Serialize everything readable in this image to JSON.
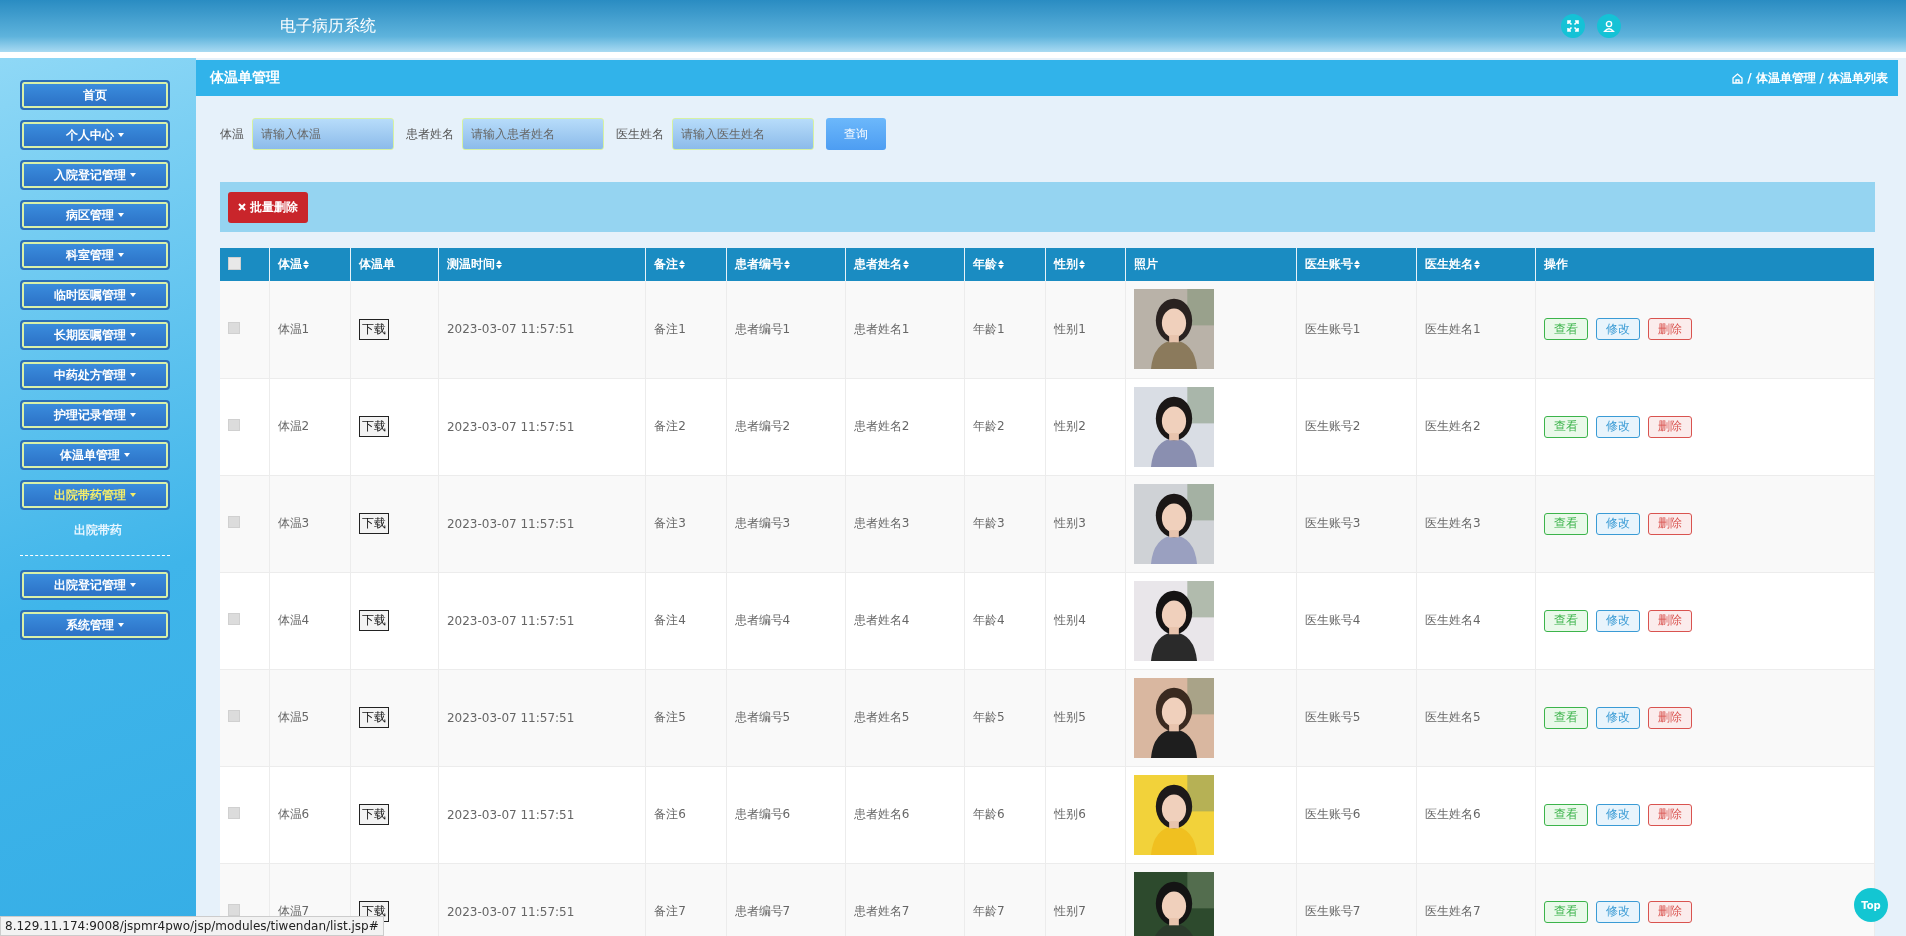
{
  "header": {
    "title": "电子病历系统"
  },
  "sidebar": {
    "items": [
      {
        "label": "首页",
        "has_caret": false,
        "selected": false
      },
      {
        "label": "个人中心",
        "has_caret": true,
        "selected": false
      },
      {
        "label": "入院登记管理",
        "has_caret": true,
        "selected": false
      },
      {
        "label": "病区管理",
        "has_caret": true,
        "selected": false
      },
      {
        "label": "科室管理",
        "has_caret": true,
        "selected": false
      },
      {
        "label": "临时医嘱管理",
        "has_caret": true,
        "selected": false
      },
      {
        "label": "长期医嘱管理",
        "has_caret": true,
        "selected": false
      },
      {
        "label": "中药处方管理",
        "has_caret": true,
        "selected": false
      },
      {
        "label": "护理记录管理",
        "has_caret": true,
        "selected": false
      },
      {
        "label": "体温单管理",
        "has_caret": true,
        "selected": false
      },
      {
        "label": "出院带药管理",
        "has_caret": true,
        "selected": true,
        "children": [
          "出院带药"
        ]
      },
      {
        "label": "出院登记管理",
        "has_caret": true,
        "selected": false
      },
      {
        "label": "系统管理",
        "has_caret": true,
        "selected": false
      }
    ]
  },
  "page": {
    "title": "体温单管理",
    "breadcrumb": {
      "separator": "/",
      "items": [
        "体温单管理",
        "体温单列表"
      ]
    }
  },
  "search": {
    "fields": [
      {
        "label": "体温",
        "placeholder": "请输入体温"
      },
      {
        "label": "患者姓名",
        "placeholder": "请输入患者姓名"
      },
      {
        "label": "医生姓名",
        "placeholder": "请输入医生姓名"
      }
    ],
    "button": "查询"
  },
  "toolbar": {
    "batch_delete": "批量删除"
  },
  "table": {
    "header_checked": false,
    "columns": [
      {
        "label": "体温",
        "sortable": true
      },
      {
        "label": "体温单",
        "sortable": false
      },
      {
        "label": "测温时间",
        "sortable": true
      },
      {
        "label": "备注",
        "sortable": true
      },
      {
        "label": "患者编号",
        "sortable": true
      },
      {
        "label": "患者姓名",
        "sortable": true
      },
      {
        "label": "年龄",
        "sortable": true
      },
      {
        "label": "性别",
        "sortable": true
      },
      {
        "label": "照片",
        "sortable": false
      },
      {
        "label": "医生账号",
        "sortable": true
      },
      {
        "label": "医生姓名",
        "sortable": true
      },
      {
        "label": "操作",
        "sortable": false
      }
    ],
    "rows": [
      {
        "checked": false,
        "temp": "体温1",
        "file": "下载",
        "time": "2023-03-07 11:57:51",
        "note": "备注1",
        "patient_no": "患者编号1",
        "patient_name": "患者姓名1",
        "age": "年龄1",
        "sex": "性别1",
        "doctor_account": "医生账号1",
        "doctor_name": "医生姓名1",
        "actions": [
          {
            "kind": "view",
            "label": "查看"
          },
          {
            "kind": "edit",
            "label": "修改"
          },
          {
            "kind": "delete",
            "label": "删除"
          }
        ]
      },
      {
        "checked": false,
        "temp": "体温2",
        "file": "下载",
        "time": "2023-03-07 11:57:51",
        "note": "备注2",
        "patient_no": "患者编号2",
        "patient_name": "患者姓名2",
        "age": "年龄2",
        "sex": "性别2",
        "doctor_account": "医生账号2",
        "doctor_name": "医生姓名2",
        "actions": [
          {
            "kind": "view",
            "label": "查看"
          },
          {
            "kind": "edit",
            "label": "修改"
          },
          {
            "kind": "delete",
            "label": "删除"
          }
        ]
      },
      {
        "checked": false,
        "temp": "体温3",
        "file": "下载",
        "time": "2023-03-07 11:57:51",
        "note": "备注3",
        "patient_no": "患者编号3",
        "patient_name": "患者姓名3",
        "age": "年龄3",
        "sex": "性别3",
        "doctor_account": "医生账号3",
        "doctor_name": "医生姓名3",
        "actions": [
          {
            "kind": "view",
            "label": "查看"
          },
          {
            "kind": "edit",
            "label": "修改"
          },
          {
            "kind": "delete",
            "label": "删除"
          }
        ]
      },
      {
        "checked": false,
        "temp": "体温4",
        "file": "下载",
        "time": "2023-03-07 11:57:51",
        "note": "备注4",
        "patient_no": "患者编号4",
        "patient_name": "患者姓名4",
        "age": "年龄4",
        "sex": "性别4",
        "doctor_account": "医生账号4",
        "doctor_name": "医生姓名4",
        "actions": [
          {
            "kind": "view",
            "label": "查看"
          },
          {
            "kind": "edit",
            "label": "修改"
          },
          {
            "kind": "delete",
            "label": "删除"
          }
        ]
      },
      {
        "checked": false,
        "temp": "体温5",
        "file": "下载",
        "time": "2023-03-07 11:57:51",
        "note": "备注5",
        "patient_no": "患者编号5",
        "patient_name": "患者姓名5",
        "age": "年龄5",
        "sex": "性别5",
        "doctor_account": "医生账号5",
        "doctor_name": "医生姓名5",
        "actions": [
          {
            "kind": "view",
            "label": "查看"
          },
          {
            "kind": "edit",
            "label": "修改"
          },
          {
            "kind": "delete",
            "label": "删除"
          }
        ]
      },
      {
        "checked": false,
        "temp": "体温6",
        "file": "下载",
        "time": "2023-03-07 11:57:51",
        "note": "备注6",
        "patient_no": "患者编号6",
        "patient_name": "患者姓名6",
        "age": "年龄6",
        "sex": "性别6",
        "doctor_account": "医生账号6",
        "doctor_name": "医生姓名6",
        "actions": [
          {
            "kind": "view",
            "label": "查看"
          },
          {
            "kind": "edit",
            "label": "修改"
          },
          {
            "kind": "delete",
            "label": "删除"
          }
        ]
      },
      {
        "checked": false,
        "temp": "体温7",
        "file": "下载",
        "time": "2023-03-07 11:57:51",
        "note": "备注7",
        "patient_no": "患者编号7",
        "patient_name": "患者姓名7",
        "age": "年龄7",
        "sex": "性别7",
        "doctor_account": "医生账号7",
        "doctor_name": "医生姓名7",
        "actions": [
          {
            "kind": "view",
            "label": "查看"
          },
          {
            "kind": "edit",
            "label": "修改"
          },
          {
            "kind": "delete",
            "label": "删除"
          }
        ]
      }
    ]
  },
  "status_url": "8.129.11.174:9008/jspmr4pwo/jsp/modules/tiwendan/list.jsp#",
  "top_button": "Top"
}
